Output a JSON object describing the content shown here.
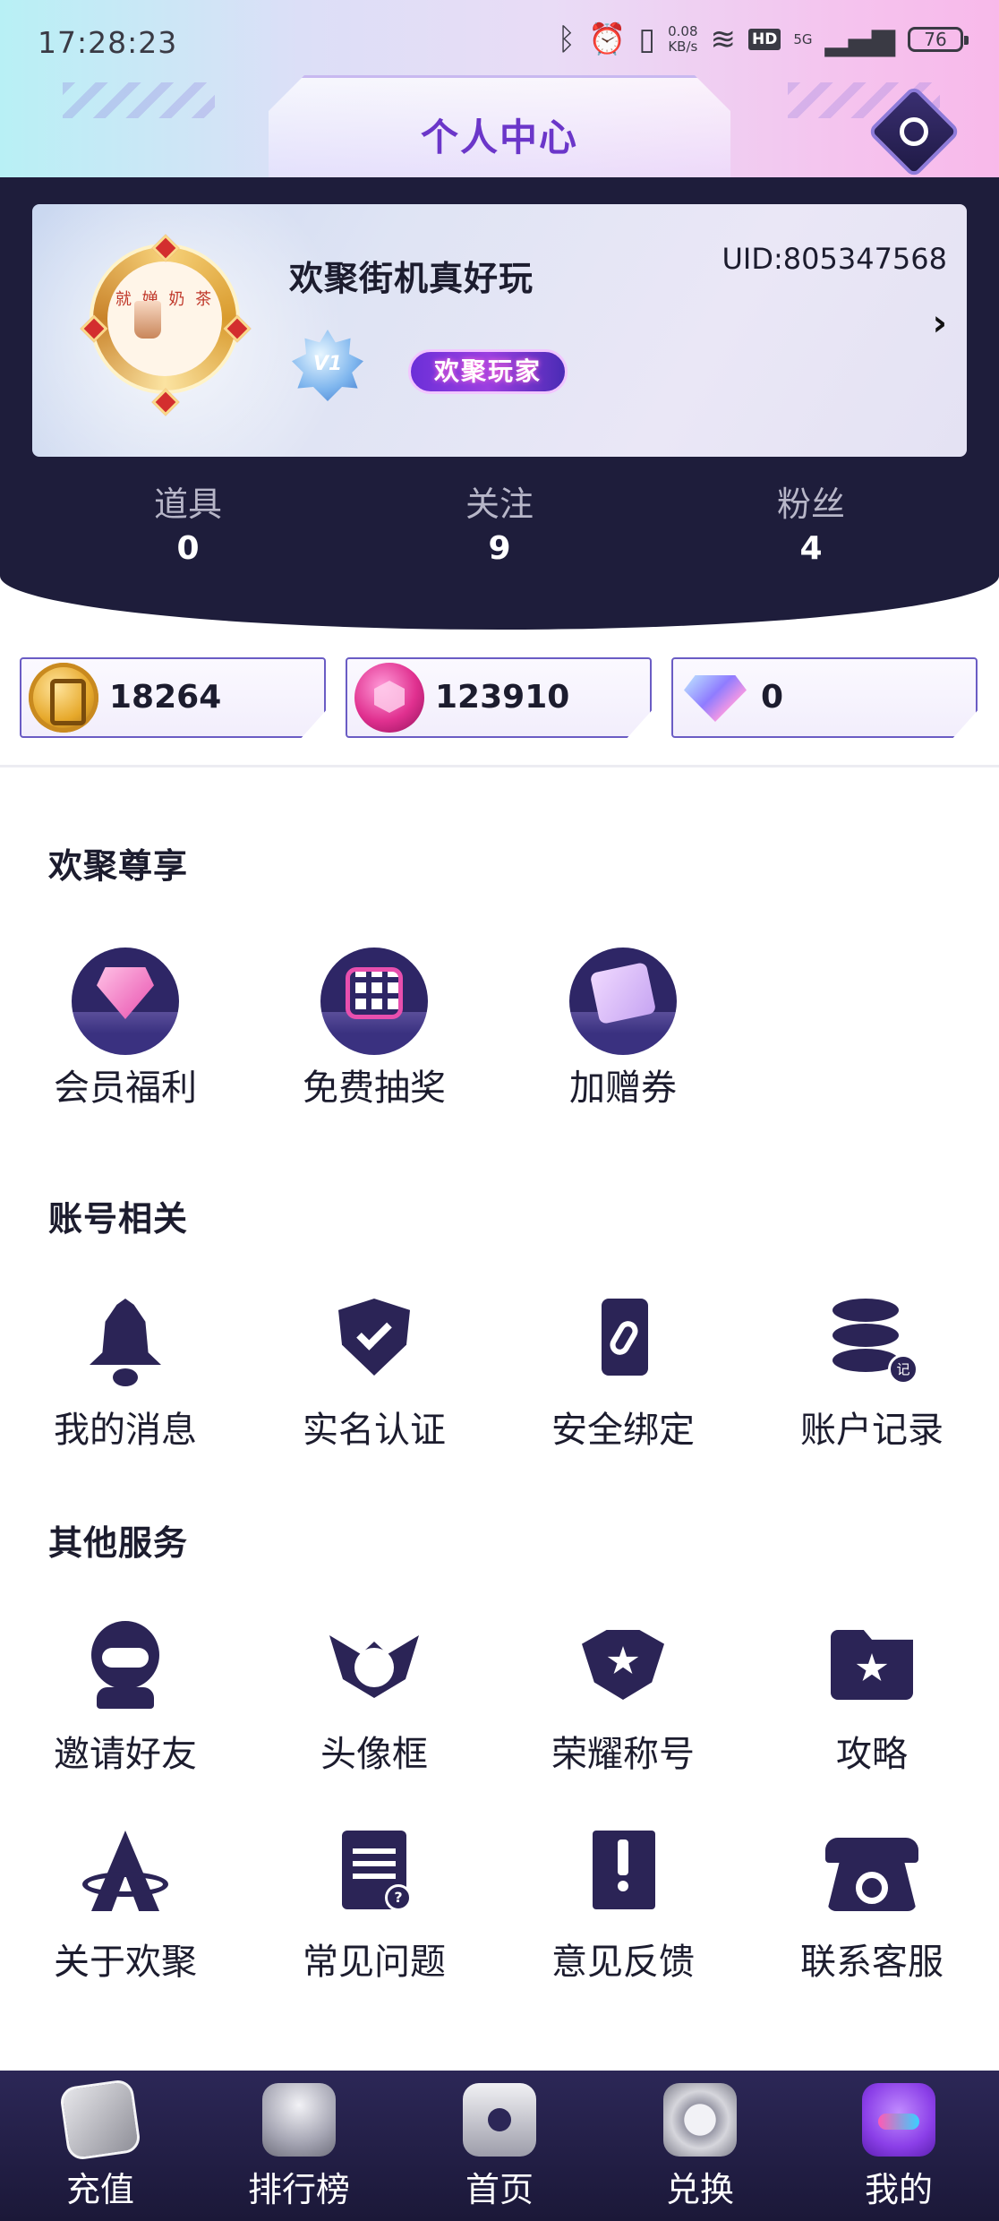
{
  "status_bar": {
    "time": "17:28:23",
    "net_speed": "0.08\nKB/s",
    "network": "5G",
    "hd": "HD",
    "battery": "76"
  },
  "header": {
    "title": "个人中心"
  },
  "profile": {
    "nickname": "欢聚街机真好玩",
    "uid": "UID:805347568",
    "vip_level": "V1",
    "role_badge": "欢聚玩家",
    "avatar_text": "就 婵 奶 茶"
  },
  "stats": [
    {
      "label": "道具",
      "value": "0"
    },
    {
      "label": "关注",
      "value": "9"
    },
    {
      "label": "粉丝",
      "value": "4"
    }
  ],
  "currencies": [
    {
      "icon": "gold-coin-icon",
      "amount": "18264"
    },
    {
      "icon": "pink-gem-coin-icon",
      "amount": "123910"
    },
    {
      "icon": "diamond-icon",
      "amount": "0"
    }
  ],
  "sections": {
    "exclusive": {
      "title": "欢聚尊享",
      "items": [
        {
          "label": "会员福利",
          "icon": "vip-diamond-icon"
        },
        {
          "label": "免费抽奖",
          "icon": "lottery-machine-icon"
        },
        {
          "label": "加赠券",
          "icon": "coupon-icon"
        }
      ]
    },
    "account": {
      "title": "账号相关",
      "items": [
        {
          "label": "我的消息",
          "icon": "bell-icon"
        },
        {
          "label": "实名认证",
          "icon": "shield-check-icon"
        },
        {
          "label": "安全绑定",
          "icon": "phone-link-icon"
        },
        {
          "label": "账户记录",
          "icon": "database-record-icon"
        }
      ]
    },
    "other": {
      "title": "其他服务",
      "items": [
        {
          "label": "邀请好友",
          "icon": "robot-friend-icon"
        },
        {
          "label": "头像框",
          "icon": "winged-frame-icon"
        },
        {
          "label": "荣耀称号",
          "icon": "star-emblem-icon"
        },
        {
          "label": "攻略",
          "icon": "star-folder-icon"
        },
        {
          "label": "关于欢聚",
          "icon": "app-logo-icon"
        },
        {
          "label": "常见问题",
          "icon": "faq-document-icon"
        },
        {
          "label": "意见反馈",
          "icon": "feedback-book-icon"
        },
        {
          "label": "联系客服",
          "icon": "telephone-icon"
        }
      ]
    }
  },
  "tabbar": [
    {
      "label": "充值",
      "icon": "recharge-icon"
    },
    {
      "label": "排行榜",
      "icon": "trophy-icon"
    },
    {
      "label": "首页",
      "icon": "home-arcade-icon"
    },
    {
      "label": "兑换",
      "icon": "exchange-icon"
    },
    {
      "label": "我的",
      "icon": "mine-avatar-icon",
      "active": true
    }
  ],
  "colors": {
    "accent_purple": "#6b36c9",
    "dark_panel": "#1e1d3b",
    "icon_dark": "#2b2456",
    "tabbar": "#2c2757"
  }
}
